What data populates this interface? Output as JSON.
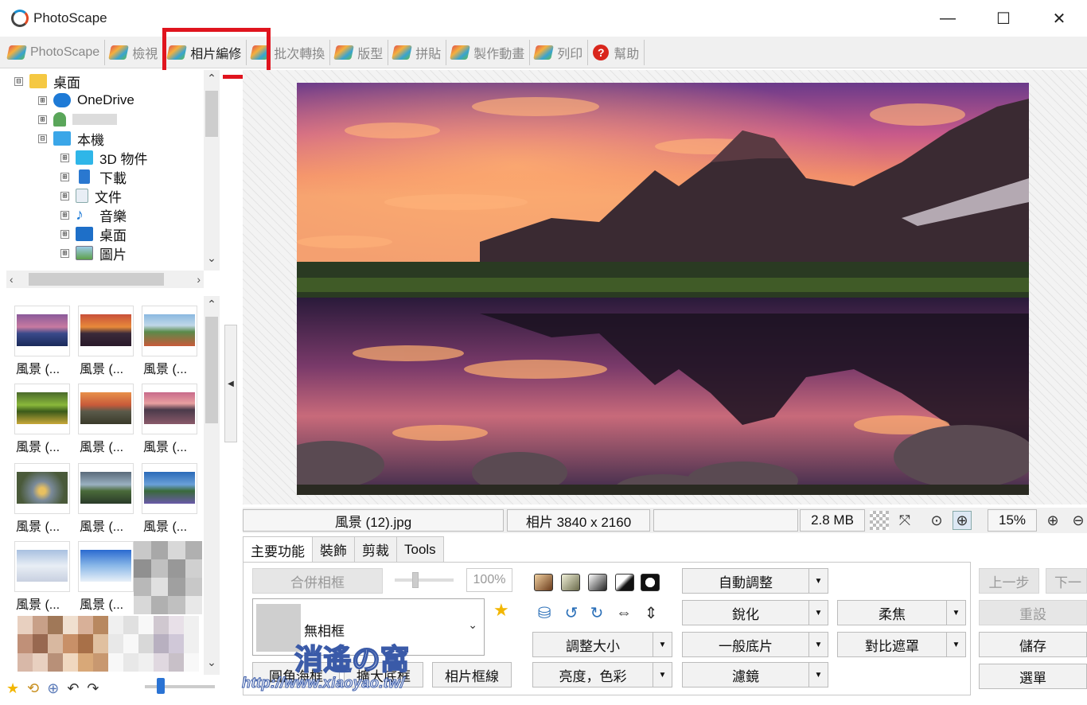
{
  "window": {
    "title": "PhotoScape",
    "minimize": "—",
    "maximize": "☐",
    "close": "✕"
  },
  "tabs": [
    {
      "label": "PhotoScape"
    },
    {
      "label": "檢視"
    },
    {
      "label": "相片編修"
    },
    {
      "label": "批次轉換"
    },
    {
      "label": "版型"
    },
    {
      "label": "拼貼"
    },
    {
      "label": "製作動畫"
    },
    {
      "label": "列印"
    },
    {
      "label": "幫助"
    }
  ],
  "tree": {
    "items": [
      {
        "label": "桌面",
        "expander": "⊟"
      },
      {
        "label": "OneDrive",
        "expander": "⊞"
      },
      {
        "label": "",
        "expander": "⊞"
      },
      {
        "label": "本機",
        "expander": "⊟"
      },
      {
        "label": "3D 物件",
        "expander": "⊞"
      },
      {
        "label": "下載",
        "expander": "⊞"
      },
      {
        "label": "文件",
        "expander": "⊞"
      },
      {
        "label": "音樂",
        "expander": "⊞"
      },
      {
        "label": "桌面",
        "expander": "⊞"
      },
      {
        "label": "圖片",
        "expander": "⊞"
      }
    ],
    "scroll_up": "⌃",
    "scroll_down": "⌄",
    "scroll_left": "‹",
    "scroll_right": "›"
  },
  "thumbnails": [
    {
      "caption": "風景 (..."
    },
    {
      "caption": "風景 (..."
    },
    {
      "caption": "風景 (..."
    },
    {
      "caption": "風景 (..."
    },
    {
      "caption": "風景 (..."
    },
    {
      "caption": "風景 (..."
    },
    {
      "caption": "風景 (..."
    },
    {
      "caption": "風景 (..."
    },
    {
      "caption": "風景 (..."
    },
    {
      "caption": "風景 (..."
    },
    {
      "caption": "風景 (..."
    }
  ],
  "status": {
    "filename": "風景 (12).jpg",
    "dimensions": "相片 3840 x 2160",
    "filesize": "2.8 MB",
    "zoom": "15%"
  },
  "edit_tabs": [
    {
      "label": "主要功能"
    },
    {
      "label": "裝飾"
    },
    {
      "label": "剪裁"
    },
    {
      "label": "Tools"
    }
  ],
  "edit": {
    "merge_frame": "合併相框",
    "frame_percent": "100%",
    "frame_name": "無相框",
    "round_corner": "圓角海框",
    "expand_frame": "擴大底框",
    "photo_frame_line": "相片框線",
    "resize": "調整大小",
    "brightness_color": "亮度，色彩",
    "auto_adjust": "自動調整",
    "sharpen": "銳化",
    "film": "一般底片",
    "filter": "濾鏡",
    "soft_focus": "柔焦",
    "contrast_mask": "對比遮罩",
    "undo": "上一步",
    "redo": "下一",
    "reset": "重設",
    "save": "儲存",
    "menu": "選單"
  },
  "watermark": {
    "title": "消遙の窩",
    "url": "http://www.xiaoyao.tw/"
  },
  "colors": {
    "highlight": "#e0141e",
    "accent": "#2a73d4"
  }
}
